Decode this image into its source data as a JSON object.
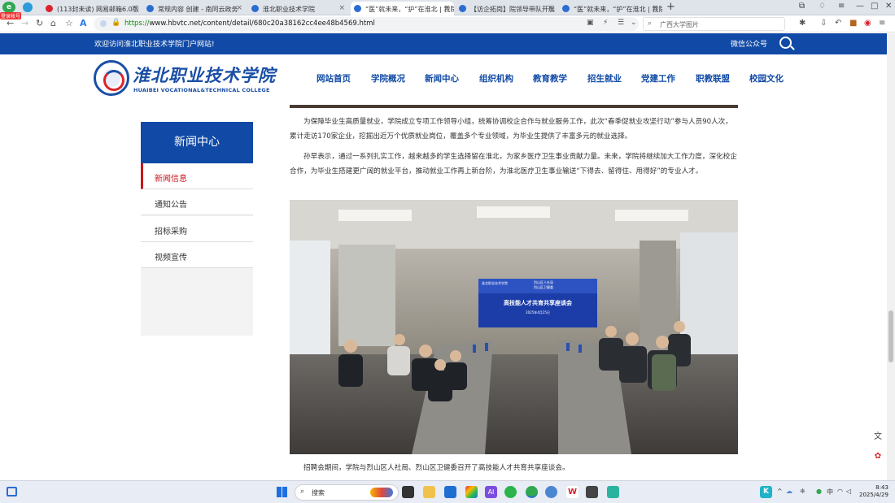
{
  "browser": {
    "tabs": [
      {
        "title": "(113封未读) 网易邮箱6.0版",
        "icon_color": "#d9232d"
      },
      {
        "title": "常规内容 创建 - 南同云政务",
        "icon_color": "#2b6cd1"
      },
      {
        "title": "淮北职业技术学院",
        "icon_color": "#2b6cd1"
      },
      {
        "title": "“医”就未来，“护”在淮北 | 我院",
        "icon_color": "#2b6cd1"
      },
      {
        "title": "【访企拓岗】院领导带队开展",
        "icon_color": "#2b6cd1"
      },
      {
        "title": "“医”就未来，“护”在淮北 | 我院",
        "icon_color": "#2b6cd1"
      }
    ],
    "active_tab": 3,
    "login_badge": "登录帐号",
    "url_scheme": "https://",
    "url_rest": "www.hbvtc.net/content/detail/680c20a38162cc4ee48b4569.html",
    "search_value": "广西大学图片"
  },
  "site": {
    "welcome": "欢迎访问淮北职业技术学院门户网站!",
    "wechat": "微信公众号",
    "logo_cn": "淮北职业技术学院",
    "logo_en": "HUAIBEI VOCATIONAL&TECHNICAL COLLEGE",
    "nav": [
      "网站首页",
      "学院概况",
      "新闻中心",
      "组织机构",
      "教育教学",
      "招生就业",
      "党建工作",
      "职教联盟",
      "校园文化"
    ]
  },
  "sidebar": {
    "title": "新闻中心",
    "items": [
      "新闻信息",
      "通知公告",
      "招标采购",
      "视频宣传"
    ],
    "active": 0
  },
  "article": {
    "p1": "为保障毕业生高质量就业，学院成立专项工作领导小组，统筹协调校企合作与就业服务工作，此次“春季促就业攻坚行动”参与人员90人次，累计走访170家企业，挖掘出近万个优质就业岗位，覆盖多个专业领域，为毕业生提供了丰富多元的就业选择。",
    "p2": "孙早表示，通过一系列扎实工作，越来越多的学生选择留在淮北，为家乡医疗卫生事业贡献力量。未来，学院将继续加大工作力度，深化校企合作，为毕业生搭建更广阔的就业平台，推动就业工作再上新台阶，为淮北医疗卫生事业输送“下得去、留得住、用得好”的专业人才。",
    "photo_screen_line1": "淮北职业技术学院",
    "photo_screen_line2": "烈山区人社局",
    "photo_screen_line3": "烈山区卫健委",
    "photo_screen_title": "高技能人才共育共享座谈会",
    "photo_screen_date": "2025年4月25日",
    "caption": "招聘会期间，学院与烈山区人社局、烈山区卫健委召开了高技能人才共育共享座谈会。"
  },
  "taskbar": {
    "search_label": "搜索",
    "time": "8:43",
    "date": "2025/4/29"
  }
}
